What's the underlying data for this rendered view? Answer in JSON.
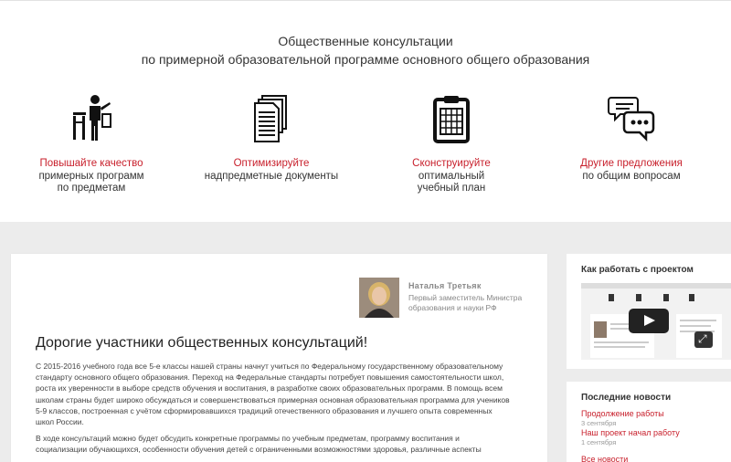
{
  "hero": {
    "title_line1": "Общественные консультации",
    "title_line2": "по примерной образовательной программе основного общего образования"
  },
  "features": [
    {
      "icon": "teacher-at-board-icon",
      "red": "Повышайте качество",
      "line2": "примерных программ",
      "line3": "по предметам"
    },
    {
      "icon": "documents-icon",
      "red": "Оптимизируйте",
      "line2": "надпредметные документы",
      "line3": ""
    },
    {
      "icon": "schedule-clipboard-icon",
      "red": "Сконструируйте",
      "line2": "оптимальный",
      "line3": "учебный план"
    },
    {
      "icon": "speech-bubbles-icon",
      "red": "Другие предложения",
      "line2": "по общим вопросам",
      "line3": ""
    }
  ],
  "author": {
    "name": "Наталья Третьяк",
    "role": "Первый заместитель Министра образования и науки РФ"
  },
  "greeting": "Дорогие участники общественных консультаций!",
  "paragraphs": [
    "С 2015-2016 учебного года все 5-е классы нашей страны начнут учиться по Федеральному государственному образовательному стандарту основного общего образования. Переход на Федеральные стандарты потребует повышения самостоятельности школ, роста их уверенности в выборе средств обучения и воспитания, в разработке своих образовательных программ. В помощь всем школам страны будет широко обсуждаться и совершенствоваться примерная основная образовательная программа для учеников 5-9 классов, построенная с учётом сформировавшихся традиций отечественного образования и лучшего опыта современных школ России.",
    "В ходе консультаций можно будет обсудить конкретные программы по учебным предметам, программу воспитания и социализации обучающихся, особенности обучения детей с ограниченными возможностями здоровья, различные аспекты"
  ],
  "sidebar": {
    "video_title": "Как работать с проектом",
    "news_title": "Последние новости",
    "news": [
      {
        "title": "Продолжение работы",
        "date": "3 сентября"
      },
      {
        "title": "Наш проект начал работу",
        "date": "1 сентября"
      }
    ],
    "all_news": "Все новости"
  },
  "colors": {
    "accent": "#c8202c",
    "page_bg": "#ececec"
  }
}
